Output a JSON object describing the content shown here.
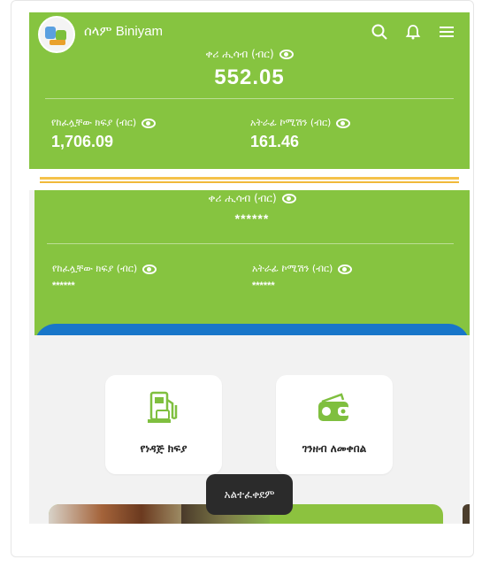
{
  "header": {
    "greeting": "ሰላም Biniyam",
    "icons": [
      "search-icon",
      "bell-icon",
      "menu-icon"
    ]
  },
  "balance_card": {
    "label": "ቀሪ ሒሳብ (ብር)",
    "value": "552.05",
    "paid_label": "የከፈሏቸው ክፍያ (ብር)",
    "paid_value": "1,706.09",
    "bonus_label": "አትራፊ ኮሚሽን (ብር)",
    "bonus_value": "161.46"
  },
  "hidden_card": {
    "label": "ቀሪ ሒሳብ (ብር)",
    "value": "******",
    "paid_label": "የከፈሏቸው ክፍያ (ብር)",
    "paid_value": "******",
    "bonus_label": "አትራፊ ኮሚሽን (ብር)",
    "bonus_value": "******"
  },
  "actions": [
    {
      "label": "የነዳጅ ክፍያ",
      "icon": "fuel-payment-icon"
    },
    {
      "label": "ገንዘብ ለመቀበል",
      "icon": "wallet-receive-icon"
    }
  ],
  "toast": {
    "text": "አልተፈቀደም"
  },
  "colors": {
    "primary_green": "#86c440",
    "blue": "#1876c9",
    "accent_yellow": "#f5c24a"
  }
}
